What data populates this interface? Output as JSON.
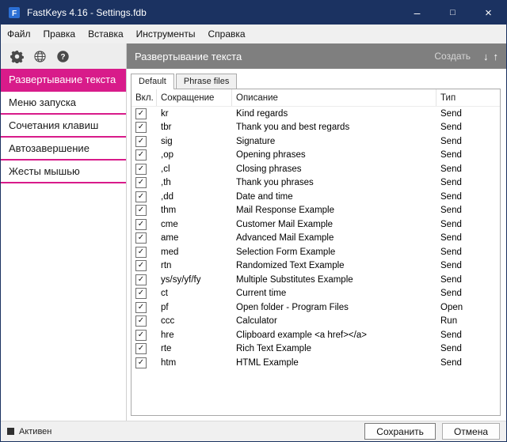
{
  "window": {
    "title": "FastKeys 4.16 - Settings.fdb",
    "minimize_icon": "–",
    "maximize_icon": "□",
    "close_icon": "×"
  },
  "colors": {
    "titlebar": "#1b3261",
    "accent": "#d81b8a",
    "section_header": "#7f7f7f"
  },
  "menu": {
    "items": [
      "Файл",
      "Правка",
      "Вставка",
      "Инструменты",
      "Справка"
    ]
  },
  "toolbar": {
    "icons": [
      "gear-icon",
      "globe-icon",
      "help-icon"
    ]
  },
  "sidebar": {
    "items": [
      {
        "label": "Развертывание текста",
        "selected": true
      },
      {
        "label": "Меню запуска",
        "selected": false
      },
      {
        "label": "Сочетания клавиш",
        "selected": false
      },
      {
        "label": "Автозавершение",
        "selected": false
      },
      {
        "label": "Жесты мышью",
        "selected": false
      }
    ]
  },
  "main": {
    "header": {
      "title": "Развертывание текста",
      "create_label": "Создать",
      "sort_down_icon": "↓",
      "sort_up_icon": "↑"
    },
    "tabs": [
      {
        "label": "Default",
        "active": true
      },
      {
        "label": "Phrase files",
        "active": false
      }
    ],
    "table": {
      "columns": [
        "Вкл.",
        "Сокращение",
        "Описание",
        "Тип"
      ],
      "rows": [
        {
          "enabled": true,
          "abbr": "kr",
          "desc": "Kind regards",
          "type": "Send"
        },
        {
          "enabled": true,
          "abbr": "tbr",
          "desc": "Thank you and best regards",
          "type": "Send"
        },
        {
          "enabled": true,
          "abbr": "sig",
          "desc": "Signature",
          "type": "Send"
        },
        {
          "enabled": true,
          "abbr": ",op",
          "desc": "Opening phrases",
          "type": "Send"
        },
        {
          "enabled": true,
          "abbr": ",cl",
          "desc": "Closing phrases",
          "type": "Send"
        },
        {
          "enabled": true,
          "abbr": ",th",
          "desc": "Thank you phrases",
          "type": "Send"
        },
        {
          "enabled": true,
          "abbr": ",dd",
          "desc": "Date and time",
          "type": "Send"
        },
        {
          "enabled": true,
          "abbr": "thm",
          "desc": "Mail Response Example",
          "type": "Send"
        },
        {
          "enabled": true,
          "abbr": "cme",
          "desc": "Customer Mail Example",
          "type": "Send"
        },
        {
          "enabled": true,
          "abbr": "ame",
          "desc": "Advanced Mail Example",
          "type": "Send"
        },
        {
          "enabled": true,
          "abbr": "med",
          "desc": "Selection Form Example",
          "type": "Send"
        },
        {
          "enabled": true,
          "abbr": "rtn",
          "desc": "Randomized Text Example",
          "type": "Send"
        },
        {
          "enabled": true,
          "abbr": "ys/sy/yf/fy",
          "desc": "Multiple Substitutes Example",
          "type": "Send"
        },
        {
          "enabled": true,
          "abbr": "ct",
          "desc": "Current time",
          "type": "Send"
        },
        {
          "enabled": true,
          "abbr": "pf",
          "desc": "Open folder - Program Files",
          "type": "Open"
        },
        {
          "enabled": true,
          "abbr": "ccc",
          "desc": "Calculator",
          "type": "Run"
        },
        {
          "enabled": true,
          "abbr": "hre",
          "desc": "Clipboard example <a href></a>",
          "type": "Send"
        },
        {
          "enabled": true,
          "abbr": "rte",
          "desc": "Rich Text Example",
          "type": "Send"
        },
        {
          "enabled": true,
          "abbr": "htm",
          "desc": "HTML Example",
          "type": "Send"
        }
      ]
    }
  },
  "footer": {
    "status": "Активен",
    "save_label": "Сохранить",
    "cancel_label": "Отмена"
  }
}
